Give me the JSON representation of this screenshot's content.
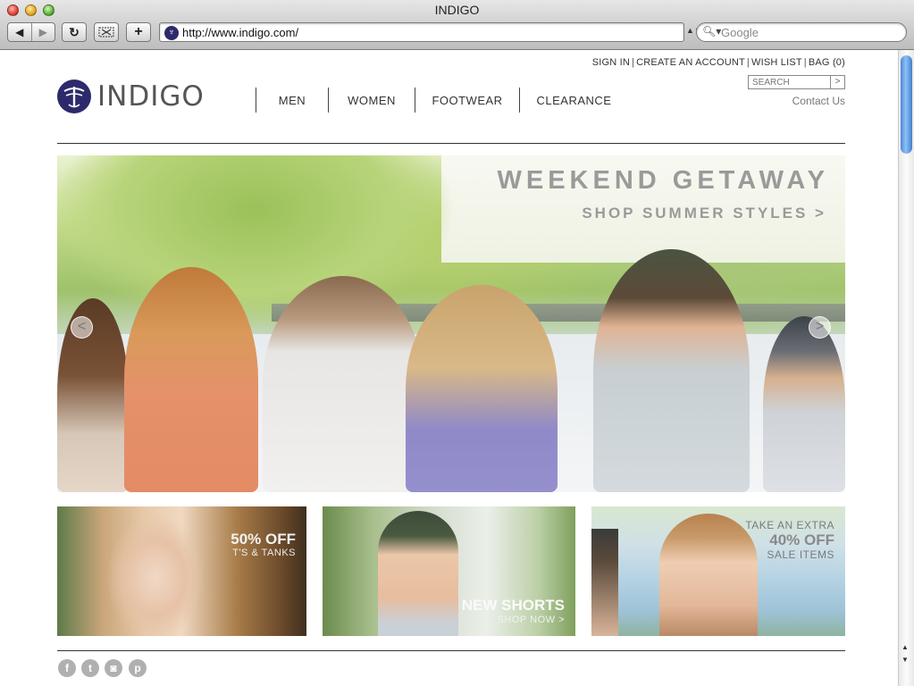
{
  "window": {
    "title": "INDIGO",
    "url": "http://www.indigo.com/",
    "search_placeholder": "Google"
  },
  "toolbar": {
    "back_icon": "◀",
    "forward_icon": "▶",
    "reload_icon": "↻",
    "add_icon": "+"
  },
  "site": {
    "logo_text": "INDIGO",
    "utility_nav": [
      "SIGN IN",
      "CREATE AN ACCOUNT",
      "WISH LIST",
      "BAG (0)"
    ],
    "search_placeholder": "SEARCH",
    "search_go": ">",
    "contact": "Contact Us",
    "main_nav": [
      "MEN",
      "WOMEN",
      "FOOTWEAR",
      "CLEARANCE"
    ]
  },
  "hero": {
    "title": "WEEKEND GETAWAY",
    "subtitle": "SHOP SUMMER STYLES >",
    "prev": "<",
    "next": ">"
  },
  "promos": [
    {
      "line1": "50% OFF",
      "line2": "T'S & TANKS"
    },
    {
      "line1": "NEW SHORTS",
      "line2": "SHOP NOW >"
    },
    {
      "line0": "TAKE AN EXTRA",
      "line1": "40% OFF",
      "line2": "SALE ITEMS"
    }
  ],
  "social": [
    {
      "icon": "facebook-icon",
      "glyph": "f"
    },
    {
      "icon": "twitter-icon",
      "glyph": "t"
    },
    {
      "icon": "instagram-icon",
      "glyph": "◙"
    },
    {
      "icon": "pinterest-icon",
      "glyph": "p"
    }
  ],
  "colors": {
    "brand": "#2d2a6b",
    "hero_text": "#9a9a9a"
  }
}
